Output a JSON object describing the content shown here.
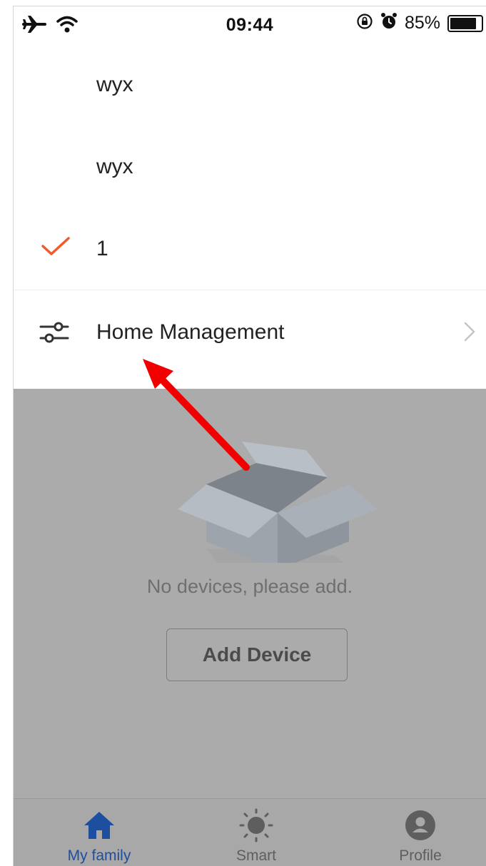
{
  "status_bar": {
    "time": "09:44",
    "battery_percent_text": "85%",
    "battery_level": 0.85,
    "icons": [
      "airplane-icon",
      "wifi-icon",
      "orientation-lock-icon",
      "alarm-icon",
      "battery-icon"
    ]
  },
  "menu": {
    "homes": [
      {
        "label": "wyx",
        "selected": false
      },
      {
        "label": "wyx",
        "selected": false
      },
      {
        "label": "1",
        "selected": true
      }
    ],
    "management_label": "Home Management",
    "check_color": "#f25a29"
  },
  "empty_state": {
    "message": "No devices, please add.",
    "add_button_label": "Add Device"
  },
  "tab_bar": {
    "tabs": [
      {
        "label": "My family",
        "icon": "home-icon",
        "active": true
      },
      {
        "label": "Smart",
        "icon": "sun-icon",
        "active": false
      },
      {
        "label": "Profile",
        "icon": "profile-icon",
        "active": false
      }
    ],
    "active_color": "#1d4fa0",
    "inactive_color": "#5e5e5e"
  },
  "annotation": {
    "color": "#f20000"
  }
}
